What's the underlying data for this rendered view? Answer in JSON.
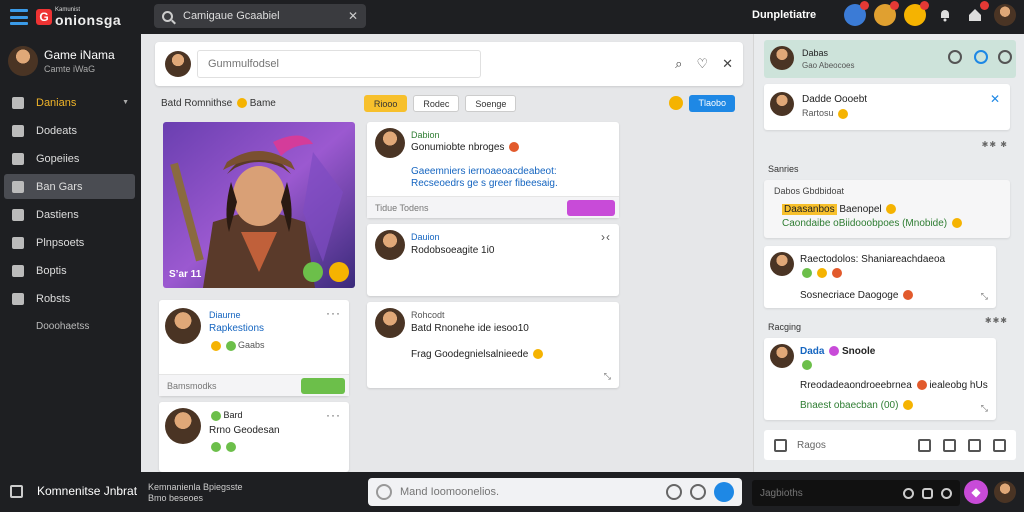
{
  "topbar": {
    "logo_small": "Kamunist",
    "logo_text": "onionsga",
    "search_value": "Camigaue Gcaabiel",
    "user_label": "Dunpletiatre"
  },
  "sidebar": {
    "profile_name": "Game iNama",
    "profile_sub": "Camte iWaG",
    "items": [
      {
        "label": "Danians"
      },
      {
        "label": "Dodeats"
      },
      {
        "label": "Gopeiies"
      },
      {
        "label": "Ban Gars"
      },
      {
        "label": "Dastiens"
      },
      {
        "label": "Plnpsoets"
      },
      {
        "label": "Boptis"
      },
      {
        "label": "Robsts"
      }
    ],
    "sub_label": "Dooohaetss"
  },
  "main": {
    "post_placeholder": "Gummulfodsel",
    "breadcrumb": "Batd Romnithse",
    "breadcrumb_tag": "Bame",
    "chips": [
      "Riooo",
      "Rodec",
      "Soenge"
    ],
    "action_button": "Tlaobo",
    "hero_label": "S’ar 11",
    "cards": {
      "c1_title": "Dabion",
      "c1_line1": "Gonumiobte nbroges",
      "c1_line2": "Gaeemniers iernoaeoacdeabeot:",
      "c1_line3": "Recseoedrs ge s greer fibeesaig.",
      "c1_foot": "Tidue Todens",
      "c2_title": "Dauion",
      "c2_line1": "Rodobsoeagite 1i0",
      "c3_title": "Rohcodt",
      "c3_line1": "Batd Rnonehe ide iesoo10",
      "c3_line2": "Frag Goodegnielsalnieede",
      "c4_title": "Diaurne",
      "c4_line1": "Rapkestions",
      "c4_line2": "Gaabs",
      "c4_foot": "Bamsmodks",
      "c5_title": "Bard",
      "c5_line1": "Rrno Geodesan"
    }
  },
  "right": {
    "head_name": "Dabas",
    "head_sub": "Gao Abeocoes",
    "c1_title": "Dadde Oooebt",
    "c1_sub": "Rartosu",
    "sec1": "Sanries",
    "c2_line1": "Dabos Gbdbidoat",
    "c2_hl": "Daasanbos",
    "c2_line2": "Baenopel",
    "c2_line3": "Caondaibe oBiidooobpoes (Mnobide)",
    "c3_line1": "Raectodolos: Shaniareachdaeoa",
    "c3_line2": "Sosnecriace Daogoge",
    "sec2": "Racging",
    "c4_name": "Dada",
    "c4_name2": "Snoole",
    "c4_line1": "Rreodadeaondroeebrnea",
    "c4_line1b": "iealeobg hUs",
    "c4_line2": "Bnaest obaecban (00)",
    "tool_label": "Ragos"
  },
  "bottombar": {
    "label": "Komnenitse Jnbrat",
    "meta1": "Kemnanienla Bpiegsste",
    "meta2": "Bmo beseoes",
    "composer_placeholder": "Mand Ioomoonelios.",
    "search_placeholder": "Jagbioths"
  }
}
